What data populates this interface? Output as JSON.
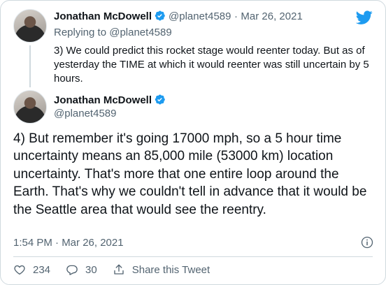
{
  "colors": {
    "text": "#0f1419",
    "muted": "#536471",
    "brand": "#1d9bf0",
    "border": "#cfd9de"
  },
  "icons": [
    "twitter-bird-icon",
    "verified-badge-icon",
    "info-icon",
    "heart-icon",
    "reply-icon",
    "share-icon"
  ],
  "parent_tweet": {
    "author_name": "Jonathan McDowell",
    "handle": "@planet4589",
    "separator": "·",
    "date": "Mar 26, 2021",
    "replying_prefix": "Replying to",
    "replying_handle": "@planet4589",
    "text": "3) We could predict this rocket stage would reenter today. But as of yesterday the TIME at which it would reenter was still uncertain by 5 hours."
  },
  "main_tweet": {
    "author_name": "Jonathan McDowell",
    "handle": "@planet4589",
    "text": "4)  But remember it's going 17000 mph, so a 5 hour time uncertainty  means an 85,000 mile (53000 km) location uncertainty. That's more that one entire loop around the Earth. That's why we couldn't tell in advance that it would be the Seattle area that would see the reentry.",
    "timestamp": "1:54 PM · Mar 26, 2021"
  },
  "actions": {
    "likes": "234",
    "replies": "30",
    "share_label": "Share this Tweet"
  }
}
